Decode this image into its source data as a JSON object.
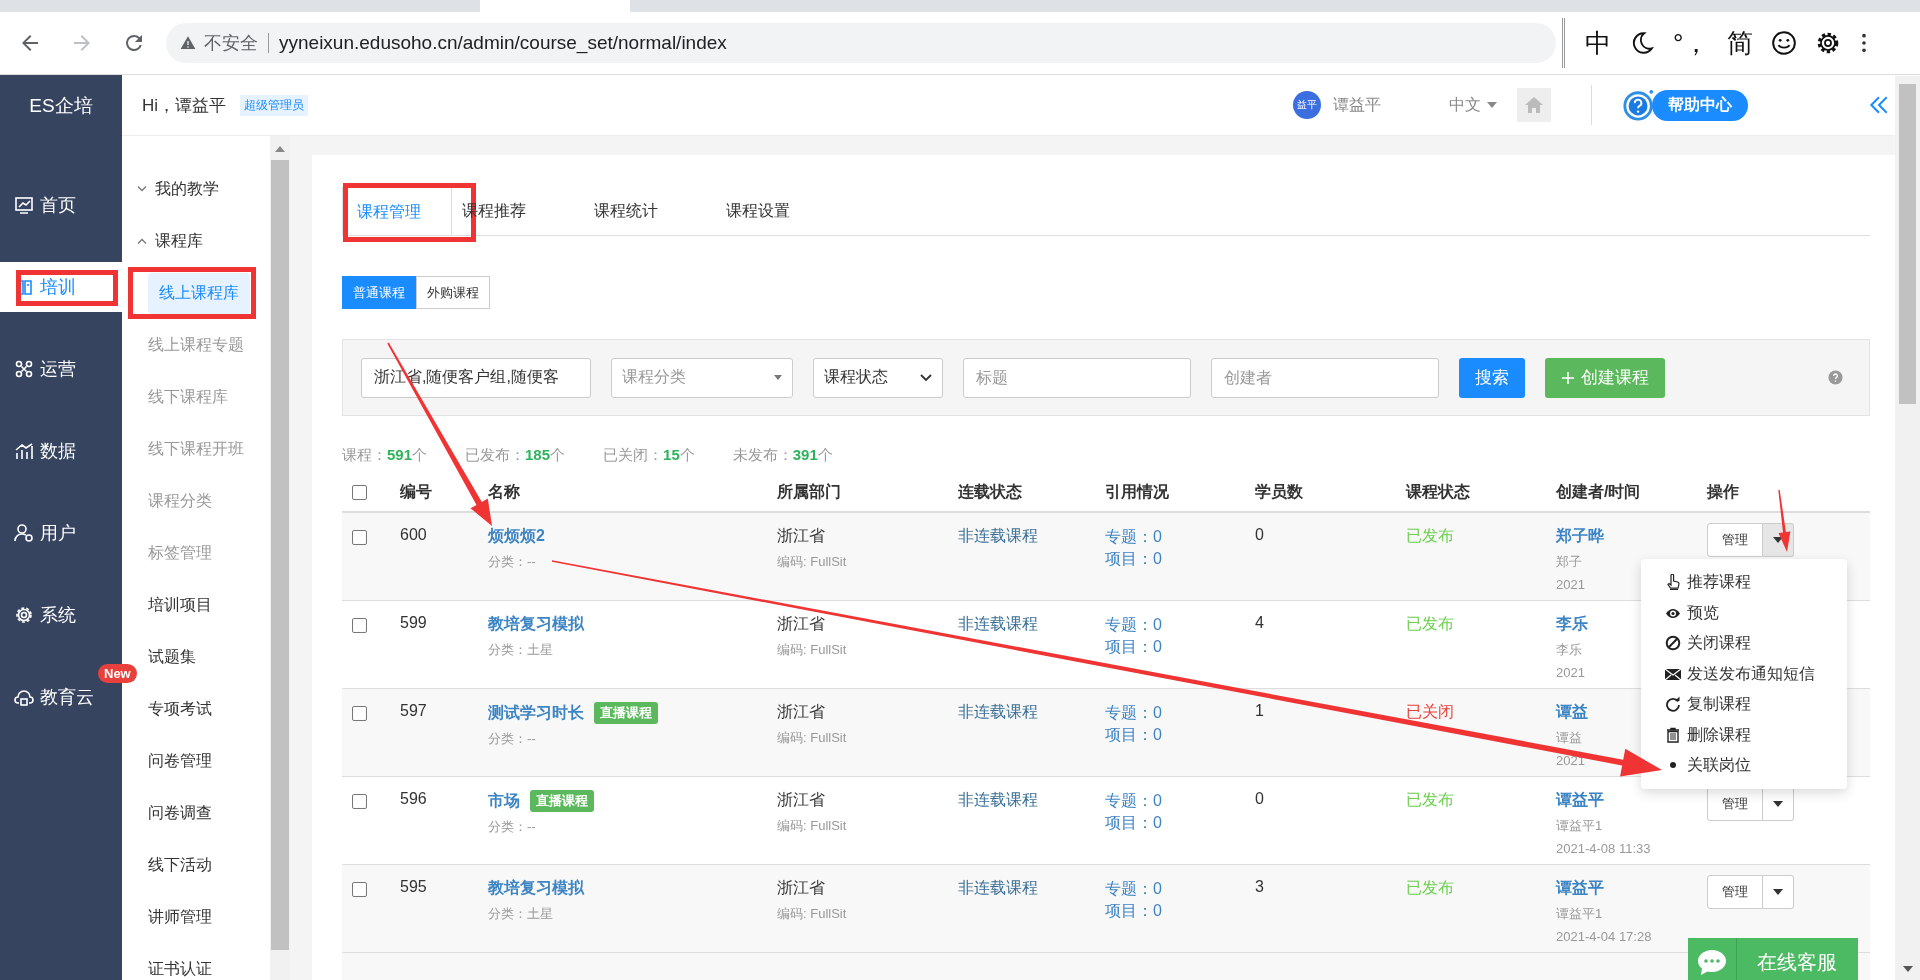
{
  "browser": {
    "security": "不安全",
    "url": "yyneixun.edusoho.cn/admin/course_set/normal/index",
    "ime": [
      "中",
      "°，",
      "简"
    ]
  },
  "header": {
    "brand": "ES企培",
    "greeting": "Hi，谭益平",
    "role_badge": "超级管理员",
    "avatar_text": "益平",
    "user_name": "谭益平",
    "language": "中文",
    "help": "帮助中心"
  },
  "nav": [
    {
      "label": "首页",
      "selected": false,
      "highlighted": false
    },
    {
      "label": "培训",
      "selected": true,
      "highlighted": true
    },
    {
      "label": "运营",
      "selected": false,
      "highlighted": false
    },
    {
      "label": "数据",
      "selected": false,
      "highlighted": false
    },
    {
      "label": "用户",
      "selected": false,
      "highlighted": false
    },
    {
      "label": "系统",
      "selected": false,
      "highlighted": false
    },
    {
      "label": "教育云",
      "selected": false,
      "highlighted": false,
      "badge": "New"
    }
  ],
  "subnav": [
    {
      "label": "我的教学",
      "kind": "group",
      "expanded": false
    },
    {
      "label": "课程库",
      "kind": "group",
      "expanded": true,
      "children": [
        {
          "label": "线上课程库",
          "selected": true,
          "highlighted": true
        },
        {
          "label": "线上课程专题",
          "selected": false,
          "highlighted": false
        },
        {
          "label": "线下课程库",
          "selected": false,
          "highlighted": false
        },
        {
          "label": "线下课程开班",
          "selected": false,
          "highlighted": false
        },
        {
          "label": "课程分类",
          "selected": false,
          "highlighted": false
        },
        {
          "label": "标签管理",
          "selected": false,
          "highlighted": false
        }
      ]
    },
    {
      "label": "培训项目",
      "kind": "link"
    },
    {
      "label": "试题集",
      "kind": "link"
    },
    {
      "label": "专项考试",
      "kind": "link"
    },
    {
      "label": "问卷管理",
      "kind": "link"
    },
    {
      "label": "问卷调查",
      "kind": "link"
    },
    {
      "label": "线下活动",
      "kind": "link"
    },
    {
      "label": "讲师管理",
      "kind": "link"
    },
    {
      "label": "证书认证",
      "kind": "link"
    }
  ],
  "tabs": [
    {
      "label": "课程管理",
      "selected": true,
      "highlighted": true
    },
    {
      "label": "课程推荐",
      "selected": false,
      "highlighted": false
    },
    {
      "label": "课程统计",
      "selected": false,
      "highlighted": false
    },
    {
      "label": "课程设置",
      "selected": false,
      "highlighted": false
    }
  ],
  "course_types": [
    {
      "label": "普通课程",
      "selected": true
    },
    {
      "label": "外购课程",
      "selected": false
    }
  ],
  "filters": {
    "department": {
      "value": "浙江省,随便客户组,随便客"
    },
    "category": {
      "placeholder": "课程分类"
    },
    "status": {
      "value": "课程状态"
    },
    "title": {
      "placeholder": "标题"
    },
    "creator": {
      "placeholder": "创建者"
    },
    "search_button": "搜索",
    "create_button": "创建课程"
  },
  "stats": [
    {
      "label": "课程：",
      "count": "591",
      "unit": "个"
    },
    {
      "label": "已发布：",
      "count": "185",
      "unit": "个"
    },
    {
      "label": "已关闭：",
      "count": "15",
      "unit": "个"
    },
    {
      "label": "未发布：",
      "count": "391",
      "unit": "个"
    }
  ],
  "table": {
    "select_all": {
      "checked": false
    },
    "columns": [
      "编号",
      "名称",
      "所属部门",
      "连载状态",
      "引用情况",
      "学员数",
      "课程状态",
      "创建者/时间",
      "操作"
    ],
    "rows": [
      {
        "checked": false,
        "id": "600",
        "name": "烦烦烦2",
        "category": "分类：--",
        "department": "浙江省",
        "code": "编码: FullSit",
        "serial": "非连载课程",
        "topics": "专题：0",
        "projects": "项目：0",
        "students": "0",
        "status": "已发布",
        "color": "#6ccf4e",
        "creator": "郑子晔",
        "creator_account": "郑子",
        "created": "2021",
        "actions": {
          "manage": "管理",
          "menu_open": true,
          "menu": [
            "推荐课程",
            "预览",
            "关闭课程",
            "发送发布通知短信",
            "复制课程",
            "删除课程",
            "关联岗位"
          ]
        }
      },
      {
        "checked": false,
        "id": "599",
        "name": "教培复习模拟",
        "category": "分类：土星",
        "department": "浙江省",
        "code": "编码: FullSit",
        "serial": "非连载课程",
        "topics": "专题：0",
        "projects": "项目：0",
        "students": "4",
        "status": "已发布",
        "color": "#6ccf4e",
        "creator": "李乐",
        "creator_account": "李乐",
        "created": "2021"
      },
      {
        "checked": false,
        "id": "597",
        "name": "测试学习时长",
        "tag": "直播课程",
        "category": "分类：--",
        "department": "浙江省",
        "code": "编码: FullSit",
        "serial": "非连载课程",
        "topics": "专题：0",
        "projects": "项目：0",
        "students": "1",
        "status": "已关闭",
        "color": "#e8403a",
        "creator": "谭益",
        "creator_account": "谭益",
        "created": "2021"
      },
      {
        "checked": false,
        "id": "596",
        "name": "市场",
        "tag": "直播课程",
        "category": "分类：--",
        "department": "浙江省",
        "code": "编码: FullSit",
        "serial": "非连载课程",
        "topics": "专题：0",
        "projects": "项目：0",
        "students": "0",
        "status": "已发布",
        "color": "#6ccf4e",
        "creator": "谭益平",
        "creator_account": "谭益平1",
        "created": "2021-4-08 11:33",
        "actions": {
          "manage": "管理",
          "menu_open": false
        }
      },
      {
        "checked": false,
        "id": "595",
        "name": "教培复习模拟",
        "category": "分类：土星",
        "department": "浙江省",
        "code": "编码: FullSit",
        "serial": "非连载课程",
        "topics": "专题：0",
        "projects": "项目：0",
        "students": "3",
        "status": "已发布",
        "color": "#6ccf4e",
        "creator": "谭益平",
        "creator_account": "谭益平1",
        "created": "2021-4-04 17:28",
        "actions": {
          "manage": "管理",
          "menu_open": false
        }
      }
    ]
  },
  "chat_widget": {
    "label": "在线客服"
  },
  "annotations": [
    {
      "kind": "arrow"
    },
    {
      "kind": "arrow"
    },
    {
      "kind": "arrow"
    }
  ]
}
